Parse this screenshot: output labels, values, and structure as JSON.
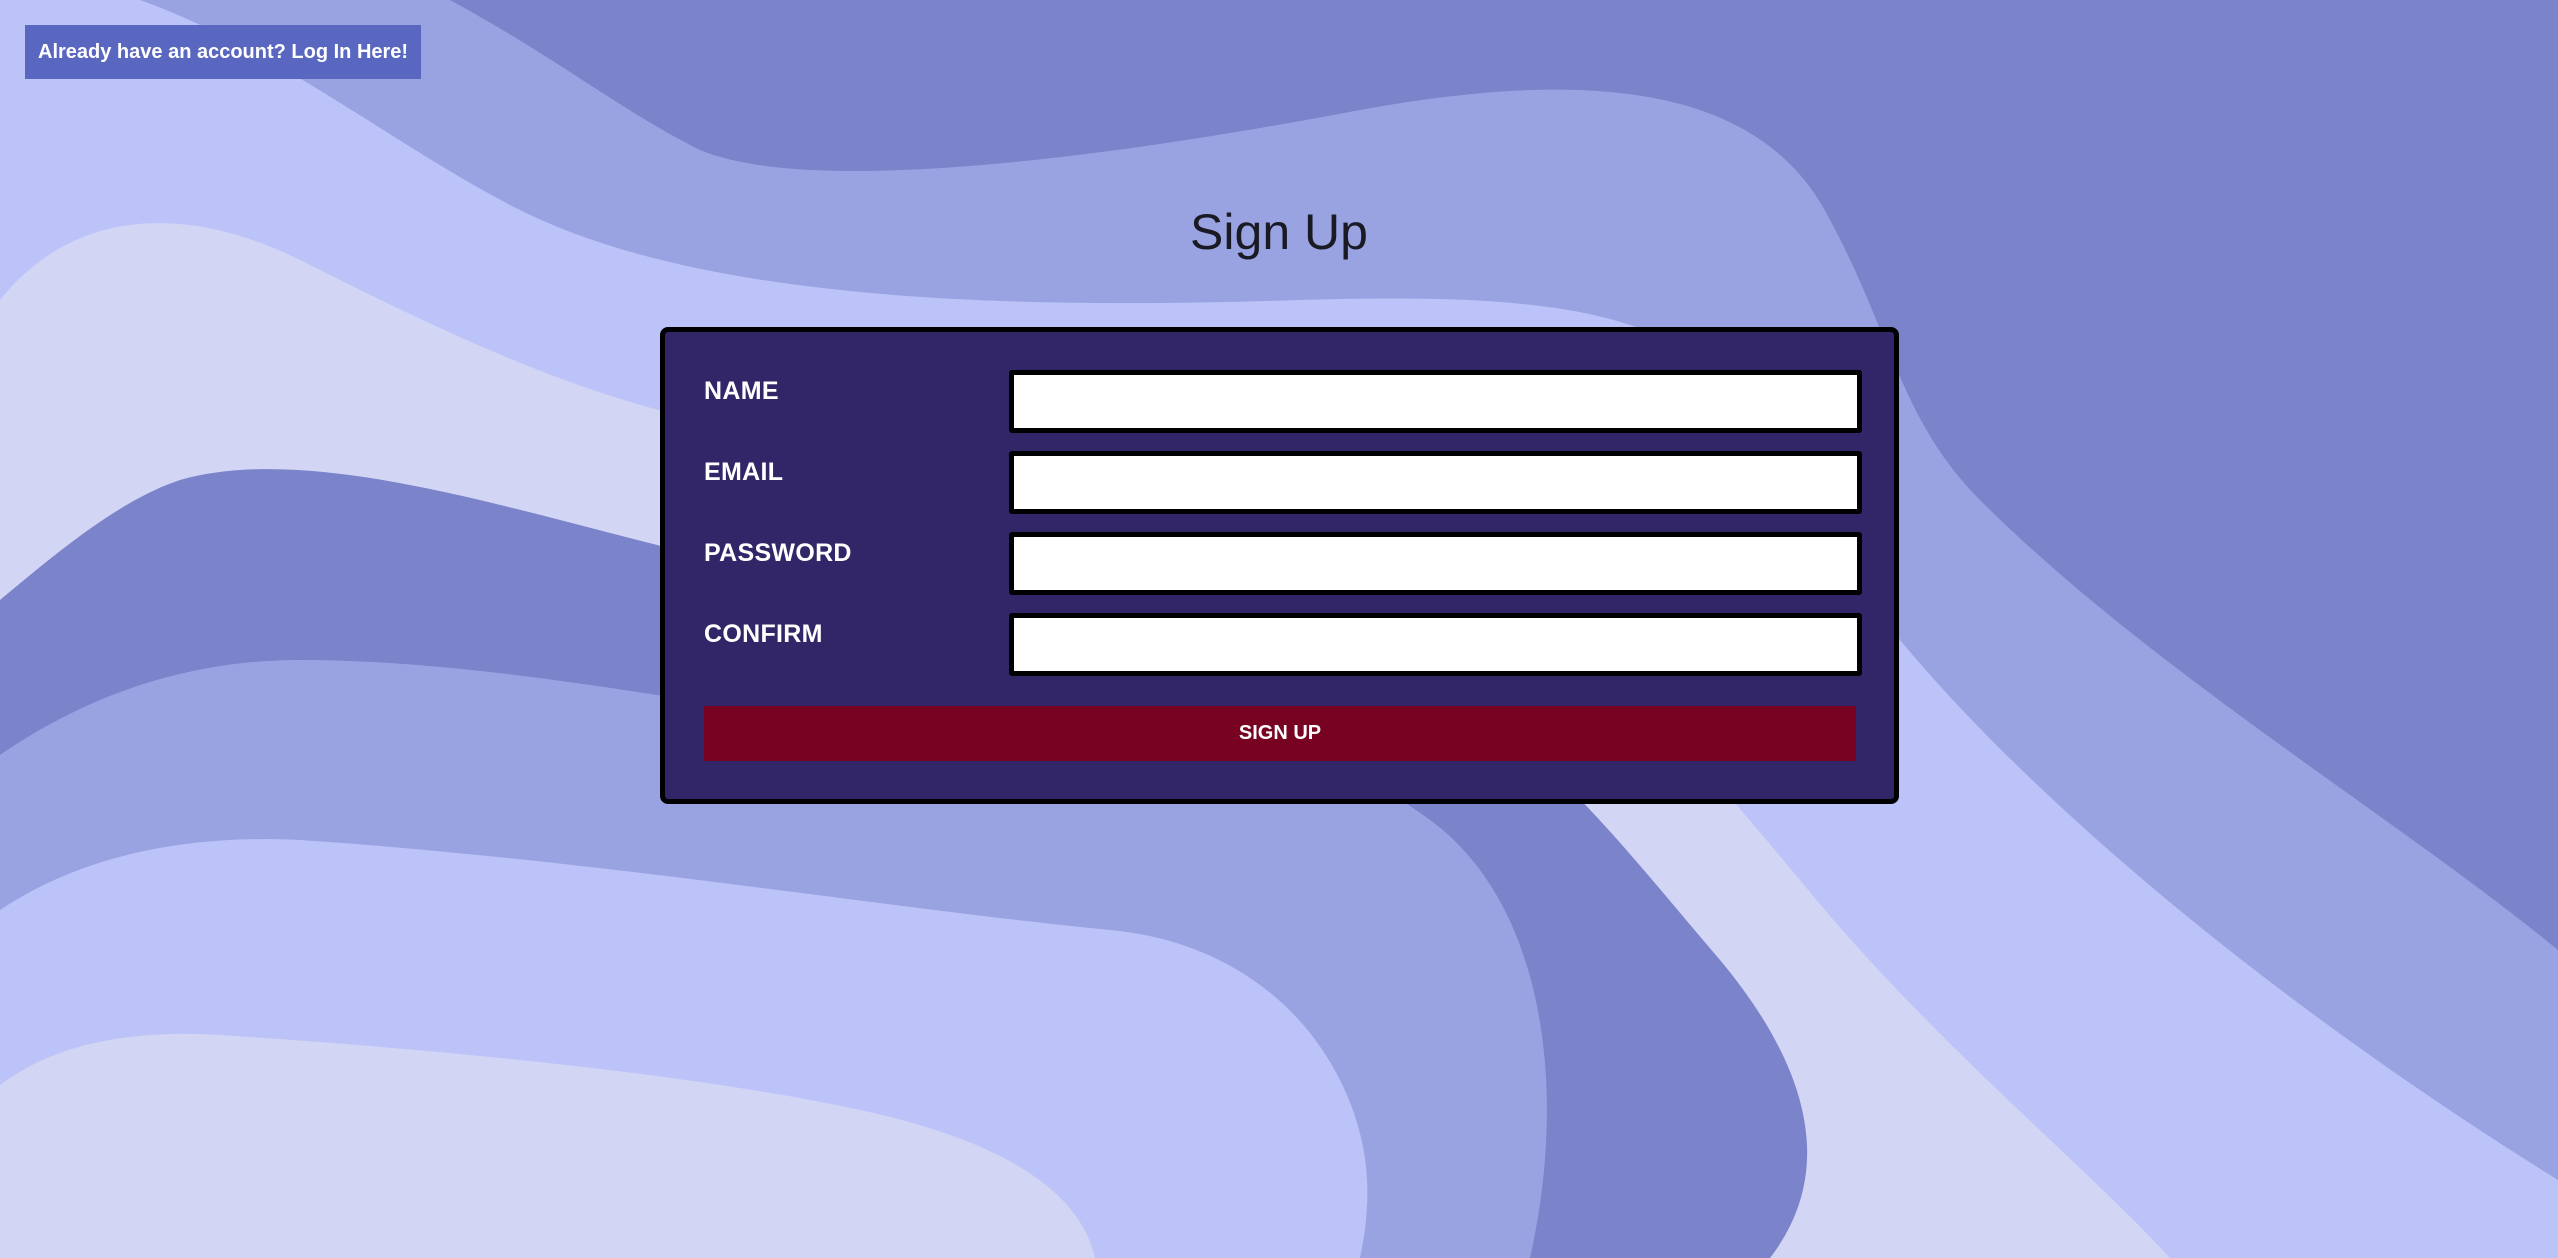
{
  "top_link": {
    "label": "Already have an account? Log In Here!"
  },
  "title": "Sign Up",
  "form": {
    "fields": [
      {
        "label": "NAME",
        "value": "",
        "placeholder": ""
      },
      {
        "label": "EMAIL",
        "value": "",
        "placeholder": ""
      },
      {
        "label": "PASSWORD",
        "value": "",
        "placeholder": ""
      },
      {
        "label": "CONFIRM",
        "value": "",
        "placeholder": ""
      }
    ],
    "submit_label": "SIGN UP"
  },
  "colors": {
    "background_dark": "#7b83ca",
    "background_mid": "#9aa3e2",
    "background_light": "#bcc3f8",
    "background_pale": "#d2d5f4",
    "link_bg": "#5a67c0",
    "card_bg": "#322668",
    "submit_bg": "#770222"
  }
}
